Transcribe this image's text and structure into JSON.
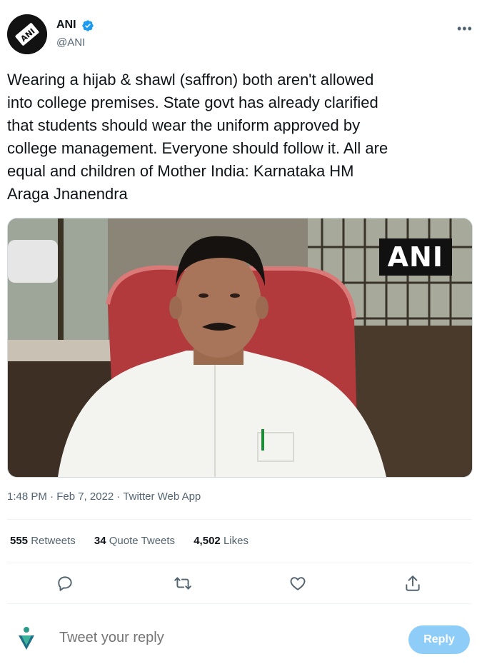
{
  "account": {
    "name": "ANI",
    "handle": "@ANI",
    "avatar_text": "ANI"
  },
  "tweet": {
    "text": "Wearing a hijab & shawl (saffron) both aren't allowed\ninto college premises. State govt has already clarified\nthat students should wear the uniform approved by\ncollege management. Everyone should follow it. All are\nequal and children of Mother India: Karnataka HM\nAraga Jnanendra",
    "media_watermark": "ANI",
    "timestamp": "1:48 PM · Feb 7, 2022 · Twitter Web App"
  },
  "stats": {
    "retweets_count": "555",
    "retweets_label": "Retweets",
    "quotes_count": "34",
    "quotes_label": "Quote Tweets",
    "likes_count": "4,502",
    "likes_label": "Likes"
  },
  "actions": {
    "icons": [
      "reply-icon",
      "retweet-icon",
      "like-icon",
      "share-icon"
    ]
  },
  "reply": {
    "placeholder": "Tweet your reply",
    "button_label": "Reply"
  },
  "colors": {
    "accent": "#1d9bf0",
    "reply_button_disabled": "#8ecdf8",
    "secondary_text": "#536471"
  }
}
